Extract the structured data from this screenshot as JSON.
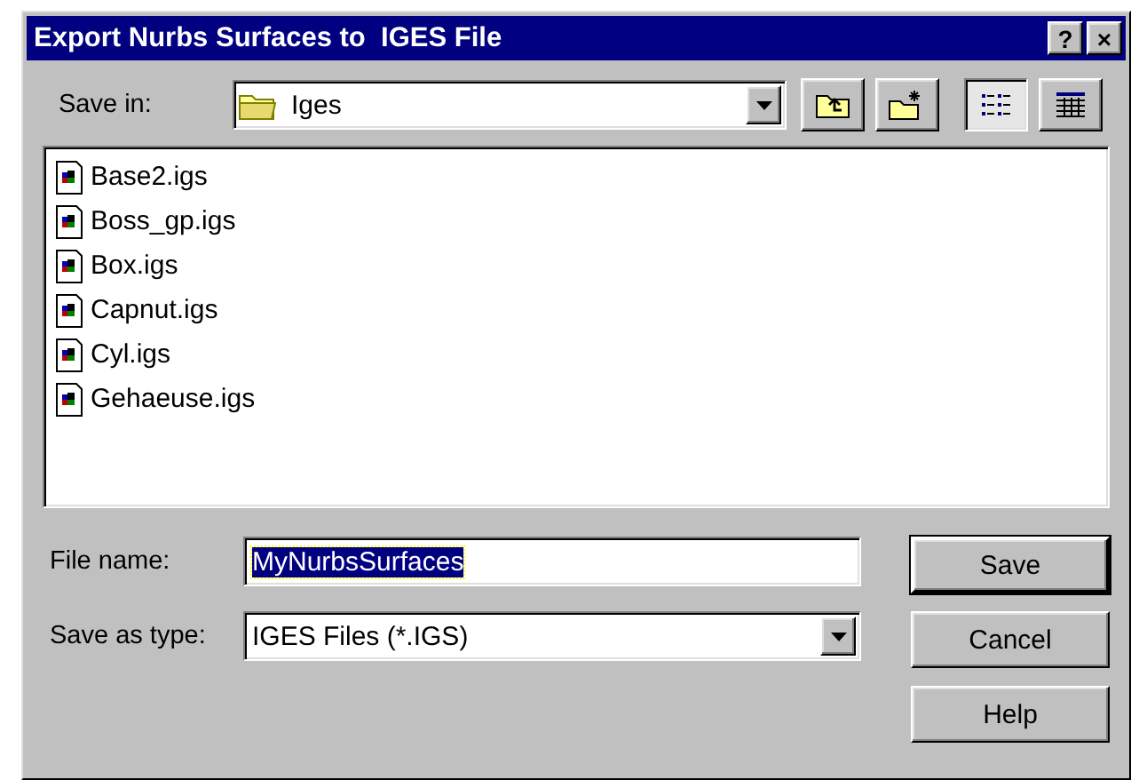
{
  "window": {
    "title": "Export Nurbs Surfaces to  IGES File",
    "title_buttons": [
      "?",
      "×"
    ]
  },
  "save_in": {
    "label": "Save in:",
    "folder": "Iges"
  },
  "toolbar": [
    {
      "kind": "up",
      "selected": false
    },
    {
      "kind": "new-folder",
      "selected": false
    },
    {
      "kind": "list",
      "selected": true
    },
    {
      "kind": "details",
      "selected": false
    }
  ],
  "files": [
    {
      "name": "Base2.igs"
    },
    {
      "name": "Boss_gp.igs"
    },
    {
      "name": "Box.igs"
    },
    {
      "name": "Capnut.igs"
    },
    {
      "name": "Cyl.igs"
    },
    {
      "name": "Gehaeuse.igs"
    }
  ],
  "file_name": {
    "label": "File name:",
    "value": "MyNurbsSurfaces",
    "selected": true
  },
  "save_as_type": {
    "label": "Save as type:",
    "value": "IGES Files (*.IGS)"
  },
  "buttons": [
    {
      "label": "Save",
      "default": true
    },
    {
      "label": "Cancel",
      "default": false
    },
    {
      "label": "Help",
      "default": false
    }
  ]
}
